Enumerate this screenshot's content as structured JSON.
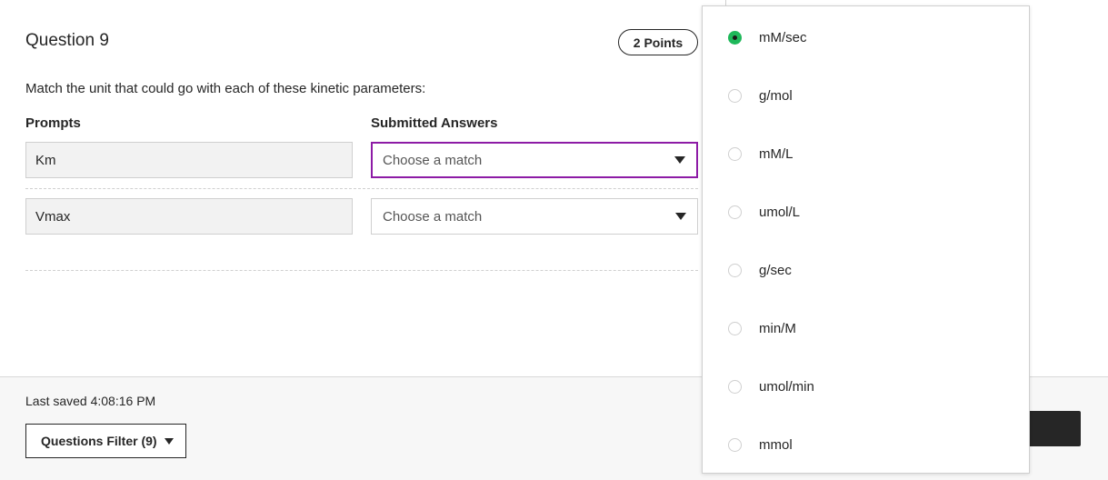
{
  "question": {
    "title": "Question 9",
    "points": "2 Points",
    "instructions": "Match the unit that could go with each of these kinetic parameters:",
    "columns": {
      "prompts": "Prompts",
      "answers": "Submitted Answers"
    },
    "rows": [
      {
        "prompt": "Km",
        "answer_placeholder": "Choose a match"
      },
      {
        "prompt": "Vmax",
        "answer_placeholder": "Choose a match"
      }
    ]
  },
  "footer": {
    "last_saved": "Last saved 4:08:16 PM",
    "filter_label": "Questions Filter (9)"
  },
  "dropdown": {
    "selected_index": 0,
    "options": [
      "mM/sec",
      "g/mol",
      "mM/L",
      "umol/L",
      "g/sec",
      "min/M",
      "umol/min",
      "mmol"
    ]
  },
  "colors": {
    "focus_border": "#8d1ba6",
    "selected_radio": "#1fb85a",
    "text": "#262626"
  }
}
